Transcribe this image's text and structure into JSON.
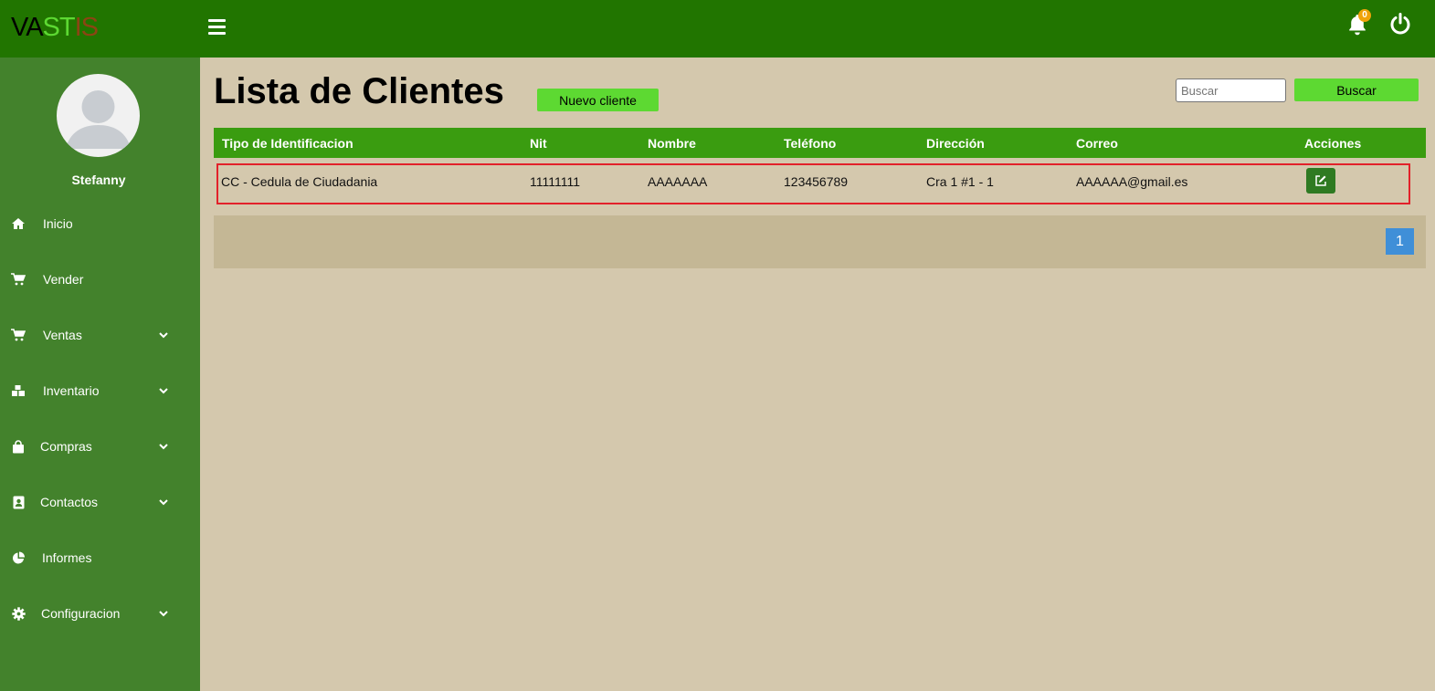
{
  "brand": {
    "letters": [
      "VA",
      "ST",
      "IS"
    ],
    "colors": [
      "#000000",
      "#5dd932",
      "#8b4513"
    ]
  },
  "header": {
    "notifications_count": "0"
  },
  "user": {
    "name": "Stefanny"
  },
  "sidebar": {
    "items": [
      {
        "label": "Inicio",
        "icon": "home-icon",
        "has_submenu": false
      },
      {
        "label": "Vender",
        "icon": "cart-icon",
        "has_submenu": false
      },
      {
        "label": "Ventas",
        "icon": "cart-icon",
        "has_submenu": true
      },
      {
        "label": "Inventario",
        "icon": "boxes-icon",
        "has_submenu": true
      },
      {
        "label": "Compras",
        "icon": "shopping-bag-icon",
        "has_submenu": true
      },
      {
        "label": "Contactos",
        "icon": "address-book-icon",
        "has_submenu": true
      },
      {
        "label": "Informes",
        "icon": "pie-chart-icon",
        "has_submenu": false
      },
      {
        "label": "Configuracion",
        "icon": "gear-icon",
        "has_submenu": true
      }
    ]
  },
  "main": {
    "title": "Lista de Clientes",
    "new_button": "Nuevo cliente",
    "search_placeholder": "Buscar",
    "search_button": "Buscar",
    "columns": [
      "Tipo de Identificacion",
      "Nit",
      "Nombre",
      "Teléfono",
      "Dirección",
      "Correo",
      "Acciones"
    ],
    "rows": [
      [
        "CC - Cedula de Ciudadania",
        "11111111",
        "AAAAAAA",
        "123456789",
        "Cra 1 #1 - 1",
        "AAAAAA@gmail.es"
      ]
    ],
    "pagination": {
      "current": "1"
    }
  },
  "colors": {
    "topbar": "#217500",
    "sidebar": "#43822c",
    "background": "#d4c8ad",
    "table_header": "#3a9c10",
    "accent_button": "#5dd932",
    "highlight_border": "#e2212a",
    "page_button": "#3f8fd8"
  }
}
